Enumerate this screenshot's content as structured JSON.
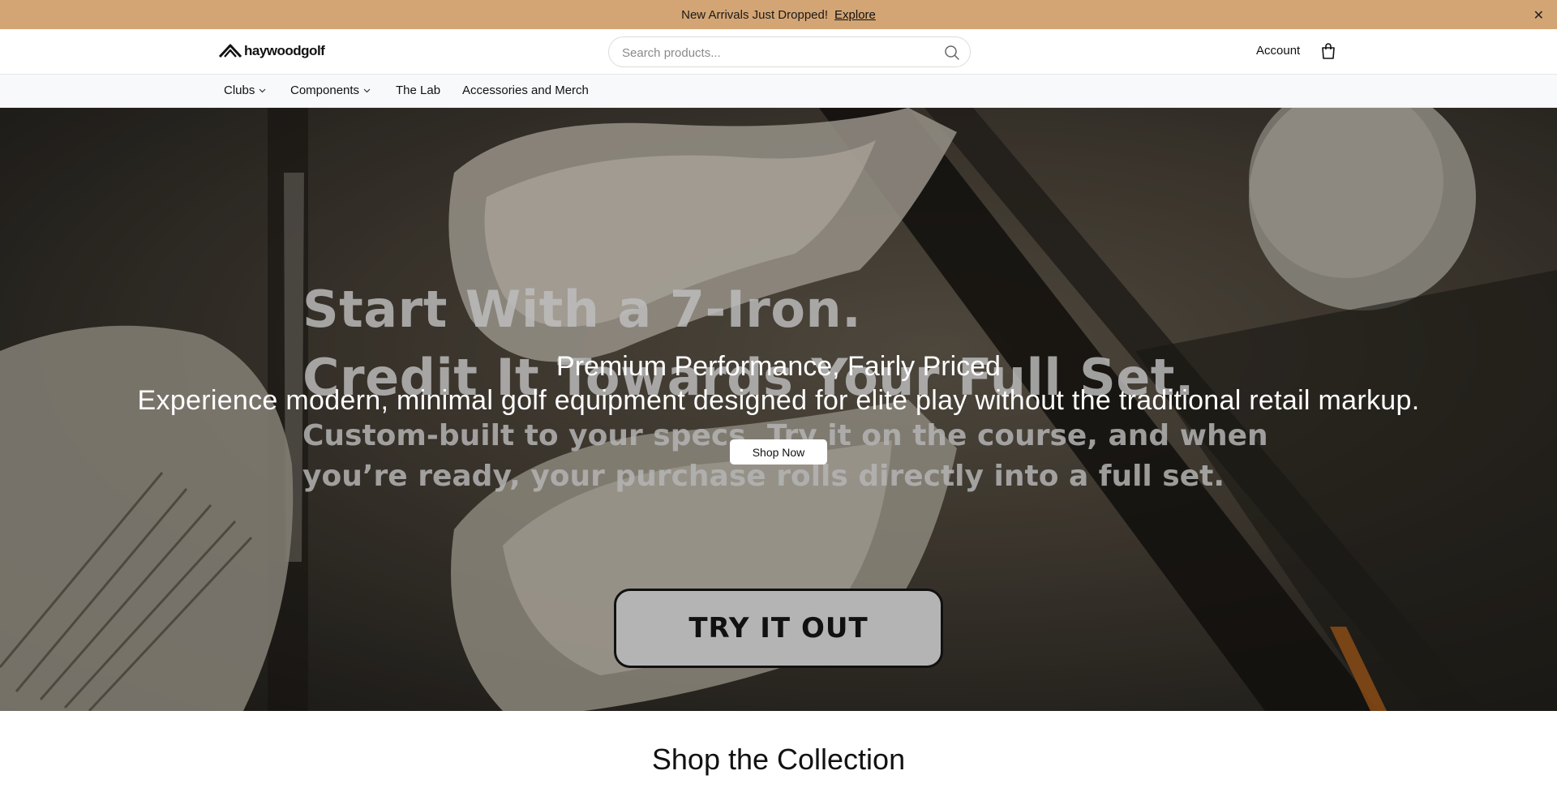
{
  "announcement": {
    "message": " New Arrivals Just Dropped!",
    "link_label": "Explore",
    "close_symbol": "✕"
  },
  "header": {
    "logo_text": "haywoodgolf",
    "search_placeholder": "Search products...",
    "account_label": "Account"
  },
  "nav": {
    "items": [
      {
        "label": "Clubs",
        "has_dropdown": true
      },
      {
        "label": "Components",
        "has_dropdown": true
      },
      {
        "label": "The Lab",
        "has_dropdown": false
      },
      {
        "label": "Accessories and Merch",
        "has_dropdown": false
      }
    ]
  },
  "hero": {
    "headline_line1": "Start With a 7-Iron.",
    "headline_line2": "Credit It Towards Your Full Set.",
    "body_copy": "Custom-built to your specs. Try it on the course, and when you’re ready, your purchase rolls directly into a full set.",
    "subtitle": "Premium Performance, Fairly Priced",
    "description": "Experience modern, minimal golf equipment designed for elite play without the traditional retail markup.",
    "shop_now_label": "Shop Now",
    "try_it_label": "TRY IT OUT"
  },
  "collection": {
    "title": "Shop the Collection"
  },
  "colors": {
    "announcement_bg": "#d4a574",
    "nav_bg": "#f8f9fa",
    "try_button_bg": "#b4b4b4"
  },
  "icons": {
    "search": "search-icon",
    "bag": "shopping-bag-icon",
    "close": "close-icon",
    "chevron": "chevron-down-icon",
    "logo": "logo-mark-icon"
  }
}
